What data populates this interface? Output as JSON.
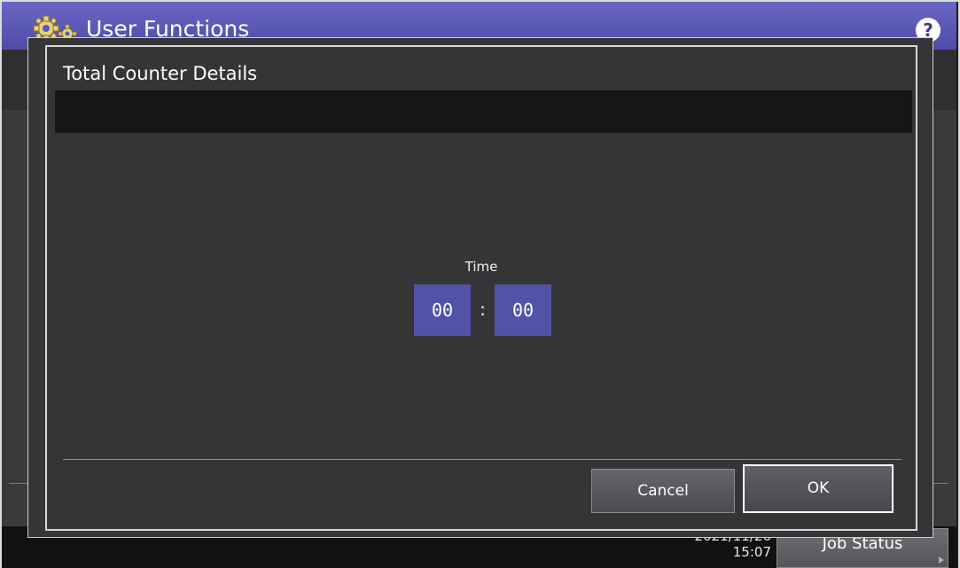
{
  "app": {
    "title": "User Functions",
    "help_glyph": "?",
    "icon": "gear-icon"
  },
  "statusbar": {
    "date": "2021/11/26",
    "time": "15:07",
    "job_status_label": "Job Status"
  },
  "dialog": {
    "title": "Total Counter Details",
    "time_label": "Time",
    "hours": "00",
    "separator": ":",
    "minutes": "00",
    "cancel_label": "Cancel",
    "ok_label": "OK"
  },
  "colors": {
    "titlebar": "#5a5ab8",
    "time_field": "#5154a6",
    "dialog_bg": "#353538"
  }
}
